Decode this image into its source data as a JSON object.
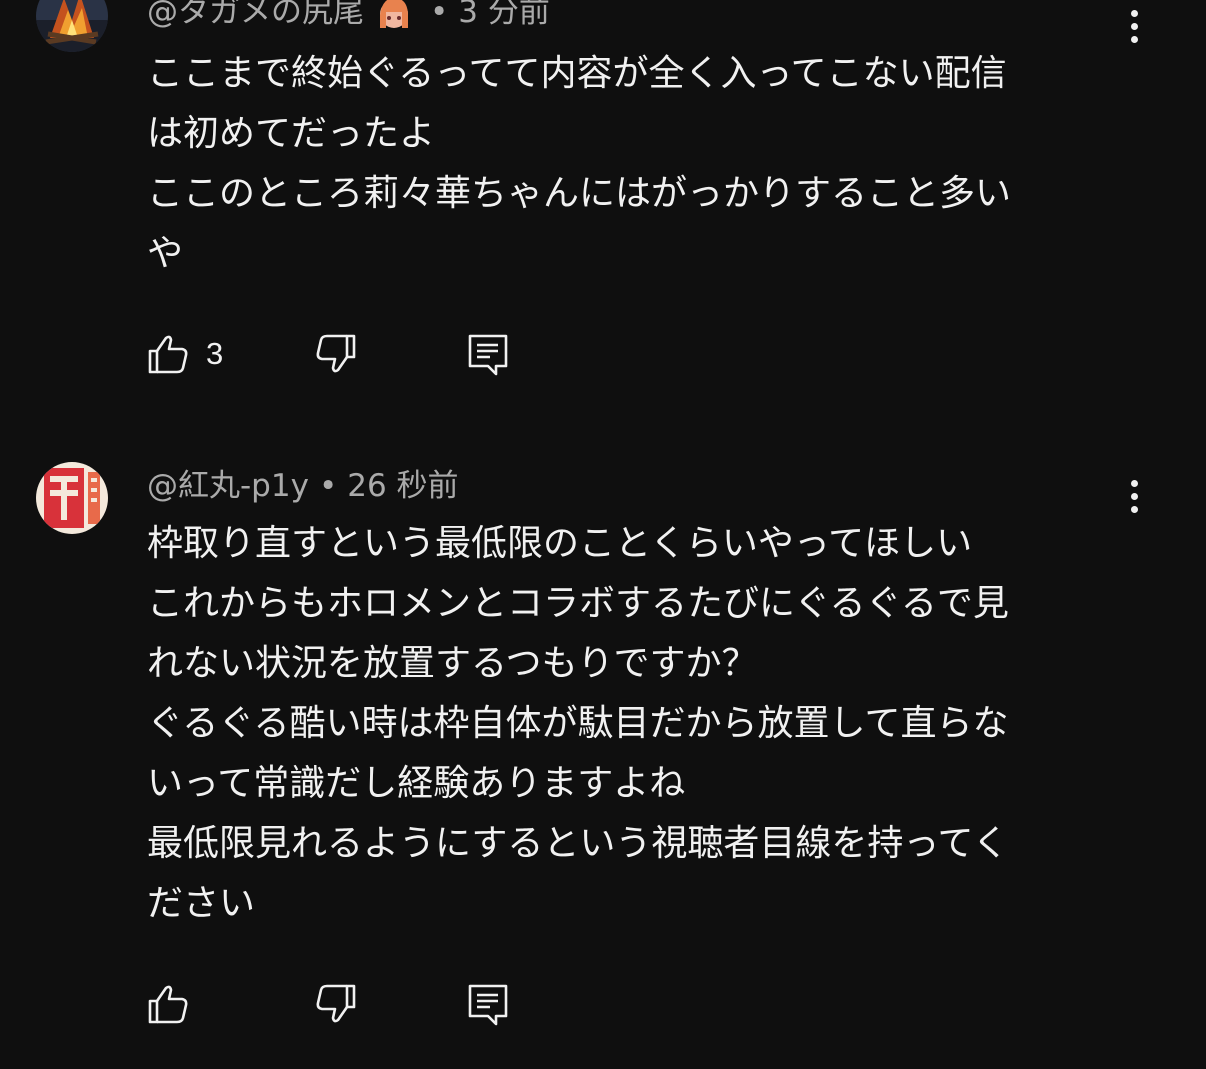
{
  "comments": [
    {
      "author": "@タガメの尻尾",
      "time": "3 分前",
      "separator": "•",
      "lines": [
        "ここまで終始ぐるってて内容が全く入ってこない配信",
        "は初めてだったよ",
        "ここのところ莉々華ちゃんにはがっかりすること多い",
        "や"
      ],
      "like_count": "3",
      "avatar_icon": "campfire-avatar",
      "badge_icon": "member-badge-icon"
    },
    {
      "author": "@紅丸-p1y",
      "time": "26 秒前",
      "separator": "•",
      "lines": [
        "枠取り直すという最低限のことくらいやってほしい",
        "これからもホロメンとコラボするたびにぐるぐるで見",
        "れない状況を放置するつもりですか？",
        "ぐるぐる酷い時は枠自体が駄目だから放置して直らな",
        "いって常識だし経験ありますよね",
        "最低限見れるようにするという視聴者目線を持ってく",
        "ださい"
      ],
      "like_count": "",
      "avatar_icon": "red-emblem-avatar"
    }
  ],
  "colors": {
    "background": "#0f0f0f",
    "text_primary": "#f1f1f1",
    "text_secondary": "#aaaaaa"
  }
}
